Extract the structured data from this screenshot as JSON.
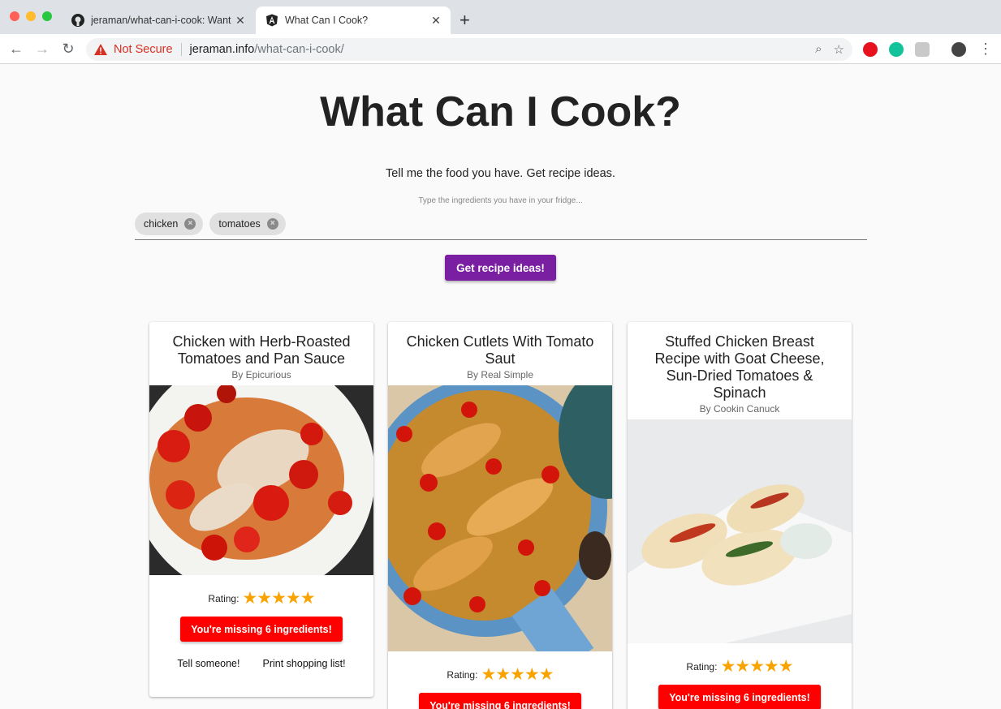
{
  "browser": {
    "tabs": [
      {
        "title": "jeraman/what-can-i-cook: Want",
        "favicon": "github-icon"
      },
      {
        "title": "What Can I Cook?",
        "favicon": "angular-icon"
      }
    ],
    "security_label": "Not Secure",
    "url_host": "jeraman.info",
    "url_path": "/what-can-i-cook/"
  },
  "header": {
    "title": "What Can I Cook?",
    "subtitle": "Tell me the food you have. Get recipe ideas."
  },
  "search": {
    "placeholder": "Type the ingredients you have in your fridge...",
    "chips": [
      "chicken",
      "tomatoes"
    ],
    "submit_label": "Get recipe ideas!"
  },
  "recipes": [
    {
      "title": "Chicken with Herb-Roasted Tomatoes and Pan Sauce",
      "source": "By Epicurious",
      "rating_label": "Rating:",
      "stars": 5,
      "missing_label": "You're missing 6 ingredients!",
      "share_label": "Tell someone!",
      "print_label": "Print shopping list!"
    },
    {
      "title": "Chicken Cutlets With Tomato Saut",
      "source": "By Real Simple",
      "rating_label": "Rating:",
      "stars": 5,
      "missing_label": "You're missing 6 ingredients!"
    },
    {
      "title": "Stuffed Chicken Breast Recipe with Goat Cheese, Sun-Dried Tomatoes & Spinach",
      "source": "By Cookin Canuck",
      "rating_label": "Rating:",
      "stars": 5,
      "missing_label": "You're missing 6 ingredients!"
    }
  ],
  "colors": {
    "primary": "#7b1fa2",
    "danger": "#ff0000",
    "star": "#f8a300"
  }
}
